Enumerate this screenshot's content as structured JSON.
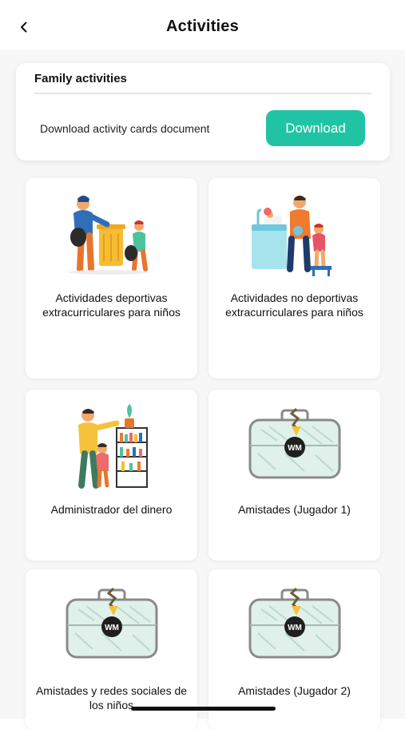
{
  "header": {
    "title": "Activities"
  },
  "family": {
    "title": "Family activities",
    "description": "Download activity cards document",
    "download_label": "Download"
  },
  "activities": [
    {
      "label": "Actividades deportivas extracurriculares para niños",
      "icon": "family-cleaning-illustration"
    },
    {
      "label": "Actividades no deportivas extracurriculares para niños",
      "icon": "family-kitchen-illustration"
    },
    {
      "label": "Administrador del dinero",
      "icon": "money-manager-illustration"
    },
    {
      "label": "Amistades (Jugador 1)",
      "icon": "briefcase-tag-icon"
    },
    {
      "label": "Amistades y redes sociales de los niños",
      "icon": "briefcase-tag-icon"
    },
    {
      "label": "Amistades (Jugador 2)",
      "icon": "briefcase-tag-icon"
    }
  ],
  "colors": {
    "accent": "#20c4a4",
    "background": "#f7f7f7",
    "card": "#ffffff"
  }
}
